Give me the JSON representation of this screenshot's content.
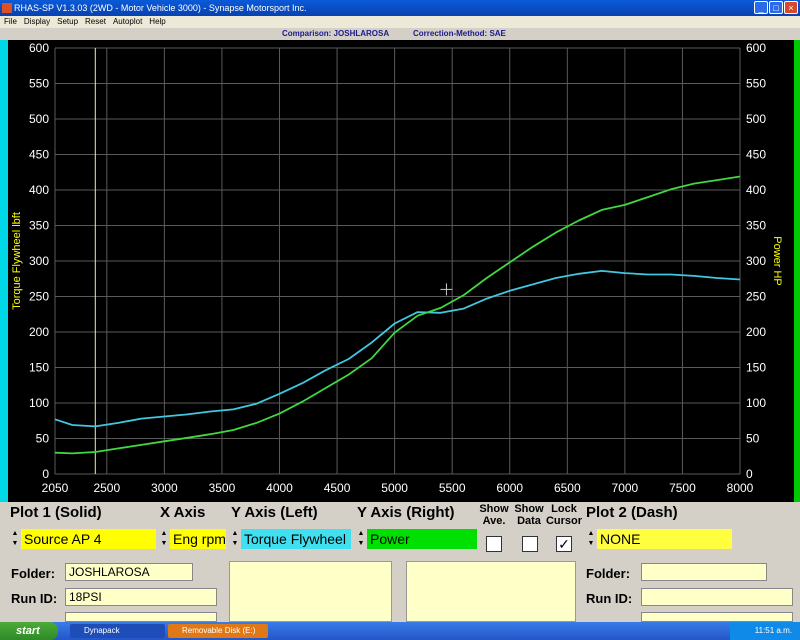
{
  "window": {
    "title": "RHAS-SP V1.3.03  (2WD - Motor Vehicle 3000) - Synapse Motorsport Inc.",
    "buttons": [
      "_",
      "□",
      "×"
    ]
  },
  "menu": [
    "File",
    "Display",
    "Setup",
    "Reset",
    "Autoplot",
    "Help"
  ],
  "info": {
    "comparison": "Comparison: JOSHLAROSA",
    "correction": "Correction-Method: SAE"
  },
  "chart_data": {
    "type": "line",
    "xlabel": "",
    "ylabel": "Torque Flywheel lbft",
    "ylabel_right": "Power HP",
    "xlim": [
      2050,
      8000
    ],
    "ylim": [
      0,
      600
    ],
    "ylim_right": [
      0,
      600
    ],
    "x_ticks": [
      2050,
      2500,
      3000,
      3500,
      4000,
      4500,
      5000,
      5500,
      6000,
      6500,
      7000,
      7500,
      8000
    ],
    "y_ticks": [
      0,
      50,
      100,
      150,
      200,
      250,
      300,
      350,
      400,
      450,
      500,
      550,
      600
    ],
    "grid": true,
    "cursor_rpm": 2400,
    "series": [
      {
        "name": "Torque Flywheel lbft",
        "color": "#40c8e0",
        "x": [
          2050,
          2200,
          2400,
          2600,
          2800,
          3000,
          3200,
          3400,
          3600,
          3800,
          4000,
          4200,
          4400,
          4600,
          4800,
          5000,
          5200,
          5400,
          5600,
          5800,
          6000,
          6200,
          6400,
          6600,
          6800,
          7000,
          7200,
          7400,
          7600,
          7800,
          8000
        ],
        "values": [
          77,
          69,
          67,
          72,
          78,
          81,
          84,
          88,
          91,
          99,
          113,
          128,
          146,
          162,
          185,
          212,
          228,
          227,
          233,
          247,
          258,
          267,
          276,
          282,
          286,
          283,
          281,
          281,
          279,
          276,
          274
        ]
      },
      {
        "name": "Power HP",
        "color": "#40d840",
        "x": [
          2050,
          2200,
          2400,
          2600,
          2800,
          3000,
          3200,
          3400,
          3600,
          3800,
          4000,
          4200,
          4400,
          4600,
          4800,
          5000,
          5200,
          5400,
          5600,
          5800,
          6000,
          6200,
          6400,
          6600,
          6800,
          7000,
          7200,
          7400,
          7600,
          7800,
          8000
        ],
        "values": [
          30,
          29,
          31,
          36,
          41,
          46,
          51,
          56,
          62,
          72,
          85,
          102,
          121,
          140,
          163,
          199,
          223,
          234,
          252,
          276,
          298,
          320,
          340,
          357,
          372,
          379,
          390,
          401,
          409,
          414,
          419
        ]
      }
    ]
  },
  "controls": {
    "plot1_label": "Plot 1 (Solid)",
    "xaxis_label": "X Axis",
    "yleft_label": "Y Axis (Left)",
    "yright_label": "Y Axis (Right)",
    "show_ave_label": "Show Ave.",
    "show_data_label": "Show Data",
    "lock_cursor_label": "Lock Cursor",
    "plot2_label": "Plot 2 (Dash)",
    "plot1_source": "Source AP 4",
    "xaxis_value": "Eng rpm",
    "yleft_value": "Torque Flywheel",
    "yright_value": "Power",
    "plot2_value": "NONE",
    "show_ave_checked": "",
    "show_data_checked": "",
    "lock_cursor_checked": "✓",
    "spin_up": "▲",
    "spin_down": "▼",
    "colors": {
      "plot1": "#ffff00",
      "xaxis": "#ffff00",
      "yleft": "#40e0f0",
      "yright": "#00e000",
      "plot2": "#ffff40"
    }
  },
  "run_info": {
    "folder_label": "Folder:",
    "folder_value": "JOSHLAROSA",
    "runid_label": "Run ID:",
    "runid_value": "18PSI",
    "folder2_label": "Folder:",
    "folder2_value": "",
    "runid2_label": "Run ID:",
    "runid2_value": ""
  },
  "taskbar": {
    "start": "start",
    "tasks": [
      "Dynapack",
      "Removable Disk (E:)"
    ],
    "clock": "11:51 a.m."
  }
}
